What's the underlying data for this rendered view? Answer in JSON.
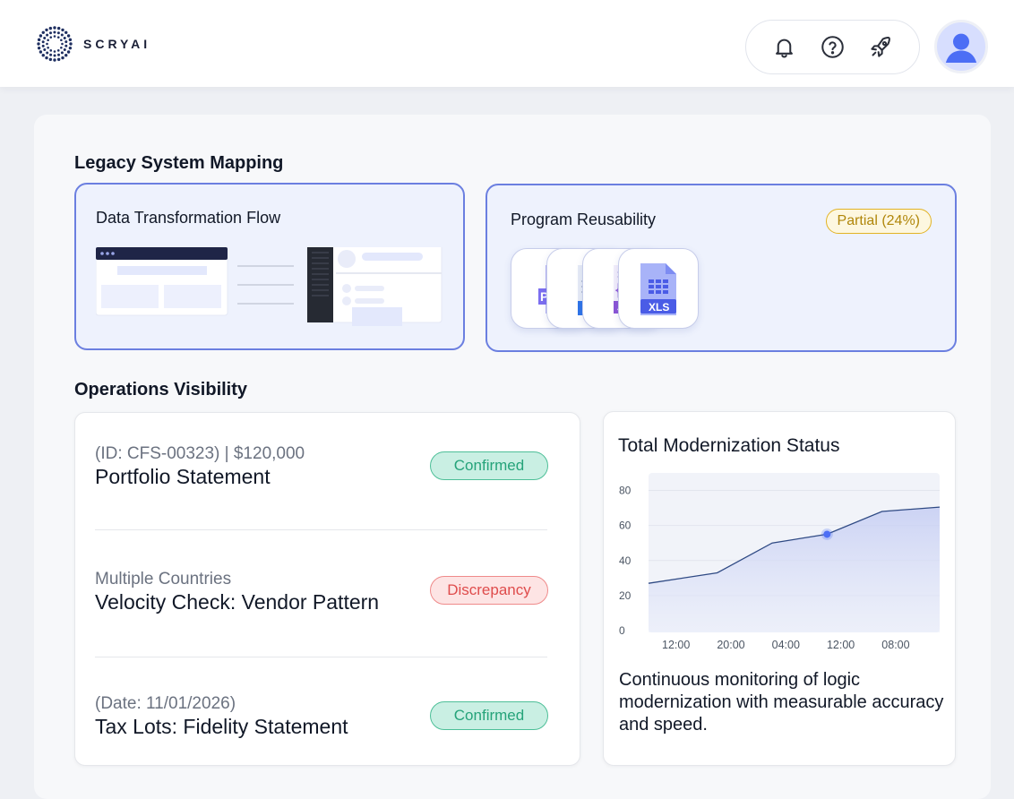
{
  "brand": {
    "name": "SCRYAI"
  },
  "header": {
    "icons": [
      "bell-icon",
      "help-circle-icon",
      "rocket-icon"
    ]
  },
  "legacy": {
    "title": "Legacy System Mapping",
    "flow_card": {
      "title": "Data Transformation Flow"
    },
    "reuse_card": {
      "title": "Program Reusability",
      "badge": "Partial (24%)",
      "badge_color": "#e2b324",
      "files": [
        {
          "label": "PD",
          "color": "#7b6ef0"
        },
        {
          "label": "D",
          "color": "#2f74e8"
        },
        {
          "label": "JS",
          "color": "#8b55d6"
        },
        {
          "label": "XLS",
          "color": "#4a5ce6"
        }
      ]
    }
  },
  "operations": {
    "title": "Operations Visibility",
    "items": [
      {
        "sub": "(ID: CFS-00323) | $120,000",
        "title": "Portfolio Statement",
        "status": "Confirmed",
        "kind": "confirmed"
      },
      {
        "sub": "Multiple Countries",
        "title": "Velocity Check: Vendor Pattern",
        "status": "Discrepancy",
        "kind": "discrepancy"
      },
      {
        "sub": "(Date: 11/01/2026)",
        "title": "Tax Lots: Fidelity Statement",
        "status": "Confirmed",
        "kind": "confirmed"
      }
    ]
  },
  "status_card": {
    "title": "Total Modernization Status",
    "description": "Continuous monitoring of logic modernization with measurable accuracy and speed."
  },
  "chart_data": {
    "type": "area",
    "title": "Total Modernization Status",
    "x_ticks": [
      "12:00",
      "20:00",
      "04:00",
      "12:00",
      "08:00"
    ],
    "y_ticks": [
      0,
      20,
      40,
      60,
      80
    ],
    "ylim": [
      0,
      90
    ],
    "xlim": [
      0,
      5.3
    ],
    "points": [
      [
        0,
        27
      ],
      [
        1.25,
        33
      ],
      [
        2.25,
        50
      ],
      [
        3.25,
        55
      ],
      [
        4.25,
        68
      ],
      [
        5.3,
        70.5
      ]
    ],
    "highlight": [
      3.25,
      55
    ],
    "line_color": "#2f4a84",
    "highlight_color": "#4c6ef5",
    "grid": true
  }
}
